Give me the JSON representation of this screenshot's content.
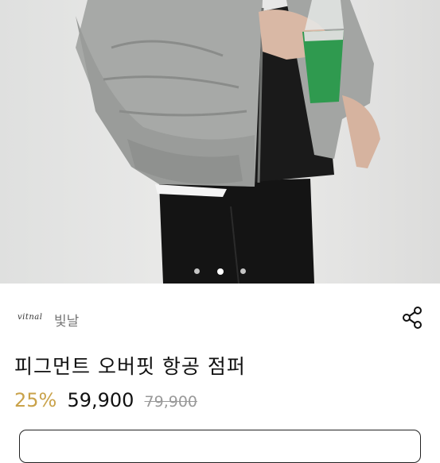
{
  "product_image": {
    "carousel": {
      "count": 3,
      "active_index": 1
    }
  },
  "brand": {
    "logo_text": "vitnal",
    "name": "빛날"
  },
  "product": {
    "title": "피그먼트 오버핏 항공 점퍼",
    "discount": "25%",
    "price": "59,900",
    "original_price": "79,900"
  },
  "icons": {
    "share": "share-icon"
  },
  "colors": {
    "discount": "#c9a24a",
    "text": "#111111",
    "muted": "#999999"
  }
}
